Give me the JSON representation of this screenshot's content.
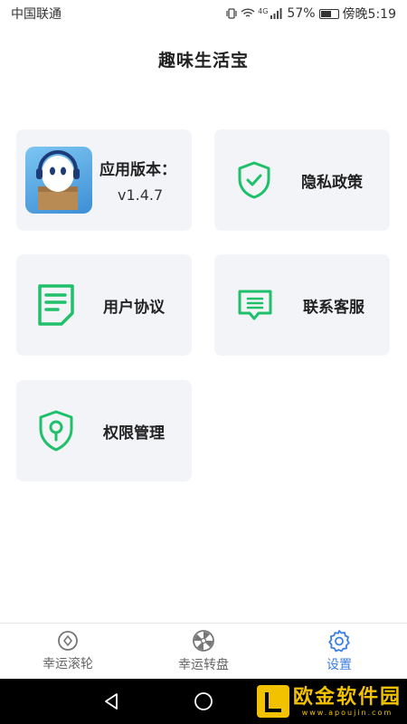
{
  "status_bar": {
    "carrier": "中国联通",
    "network": "4G",
    "battery": "57%",
    "time": "傍晚5:19"
  },
  "app_title": "趣味生活宝",
  "cards": {
    "version_label": "应用版本：",
    "version_value": "v1.4.7",
    "privacy": "隐私政策",
    "agreement": "用户协议",
    "service": "联系客服",
    "permission": "权限管理"
  },
  "tabs": [
    {
      "label": "幸运滚轮",
      "icon": "coin-icon",
      "active": false
    },
    {
      "label": "幸运转盘",
      "icon": "wheel-icon",
      "active": false
    },
    {
      "label": "设置",
      "icon": "gear-icon",
      "active": true
    }
  ],
  "watermark": {
    "title": "欧金软件园",
    "url": "www.apoujin.com"
  },
  "colors": {
    "accent_green": "#1fc06a",
    "tab_active_blue": "#3b7ee6",
    "card_bg": "#f3f4f8"
  }
}
